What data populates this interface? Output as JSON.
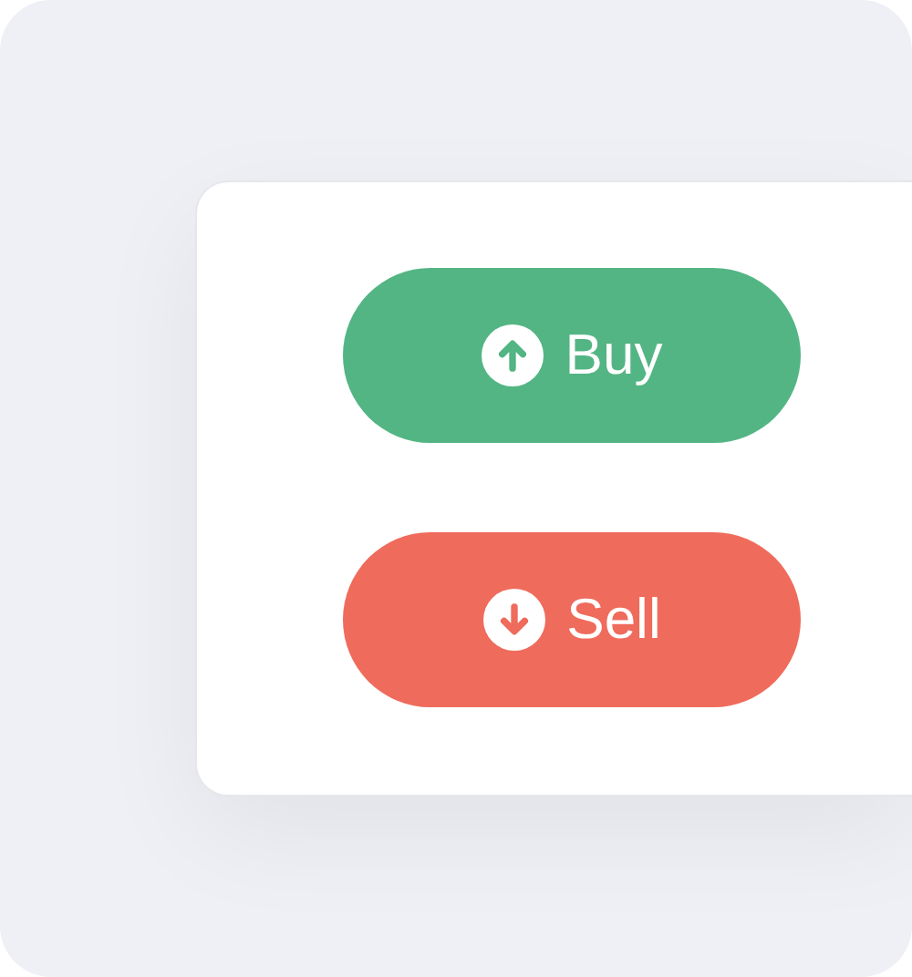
{
  "buttons": [
    {
      "label": "Buy",
      "kind": "buy"
    },
    {
      "label": "Sell",
      "kind": "sell"
    }
  ]
}
